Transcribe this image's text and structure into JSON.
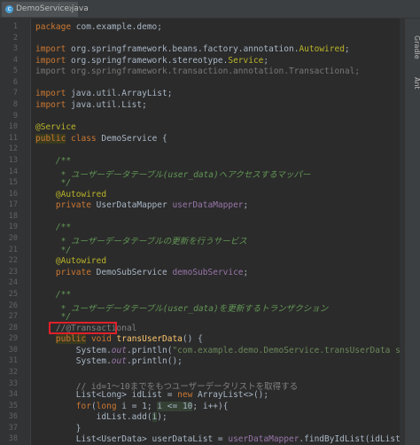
{
  "tab": {
    "label": "DemoService.java",
    "close": "×",
    "icon_letter": "c"
  },
  "right_panels": [
    "Gradle",
    "Ant"
  ],
  "lines": [
    {
      "n": "1",
      "segs": [
        {
          "t": "package ",
          "c": "kw"
        },
        {
          "t": "com.example.demo;",
          "c": ""
        }
      ]
    },
    {
      "n": "2",
      "segs": []
    },
    {
      "n": "3",
      "segs": [
        {
          "t": "import ",
          "c": "kw"
        },
        {
          "t": "org.springframework.beans.factory.annotation.",
          "c": ""
        },
        {
          "t": "Autowired",
          "c": "ann"
        },
        {
          "t": ";",
          "c": ""
        }
      ]
    },
    {
      "n": "4",
      "segs": [
        {
          "t": "import ",
          "c": "kw"
        },
        {
          "t": "org.springframework.stereotype.",
          "c": ""
        },
        {
          "t": "Service",
          "c": "ann"
        },
        {
          "t": ";",
          "c": ""
        }
      ]
    },
    {
      "n": "5",
      "segs": [
        {
          "t": "import org.springframework.transaction.annotation.Transactional;",
          "c": "gray"
        }
      ]
    },
    {
      "n": "6",
      "segs": []
    },
    {
      "n": "7",
      "segs": [
        {
          "t": "import ",
          "c": "kw"
        },
        {
          "t": "java.util.ArrayList;",
          "c": ""
        }
      ]
    },
    {
      "n": "8",
      "segs": [
        {
          "t": "import ",
          "c": "kw"
        },
        {
          "t": "java.util.List;",
          "c": ""
        }
      ]
    },
    {
      "n": "9",
      "segs": []
    },
    {
      "n": "10",
      "segs": [
        {
          "t": "@Service",
          "c": "ann"
        }
      ]
    },
    {
      "n": "11",
      "segs": [
        {
          "t": "public",
          "c": "kw-hl"
        },
        {
          "t": " class ",
          "c": "kw"
        },
        {
          "t": "DemoService {",
          "c": ""
        }
      ]
    },
    {
      "n": "12",
      "segs": []
    },
    {
      "n": "13",
      "segs": [
        {
          "t": "    /**",
          "c": "doc"
        }
      ]
    },
    {
      "n": "14",
      "segs": [
        {
          "t": "     * ユーザーデータテーブル(user_data)へアクセスするマッパー",
          "c": "doc"
        }
      ]
    },
    {
      "n": "15",
      "segs": [
        {
          "t": "     */",
          "c": "doc"
        }
      ]
    },
    {
      "n": "16",
      "segs": [
        {
          "t": "    @Autowired",
          "c": "ann"
        }
      ]
    },
    {
      "n": "17",
      "segs": [
        {
          "t": "    private ",
          "c": "kw"
        },
        {
          "t": "UserDataMapper ",
          "c": ""
        },
        {
          "t": "userDataMapper",
          "c": "fld"
        },
        {
          "t": ";",
          "c": ""
        }
      ]
    },
    {
      "n": "18",
      "segs": []
    },
    {
      "n": "19",
      "segs": [
        {
          "t": "    /**",
          "c": "doc"
        }
      ]
    },
    {
      "n": "20",
      "segs": [
        {
          "t": "     * ユーザーデータテーブルの更新を行うサービス",
          "c": "doc"
        }
      ]
    },
    {
      "n": "21",
      "segs": [
        {
          "t": "     */",
          "c": "doc"
        }
      ]
    },
    {
      "n": "22",
      "segs": [
        {
          "t": "    @Autowired",
          "c": "ann"
        }
      ]
    },
    {
      "n": "23",
      "segs": [
        {
          "t": "    private ",
          "c": "kw"
        },
        {
          "t": "DemoSubService ",
          "c": ""
        },
        {
          "t": "demoSubService",
          "c": "fld"
        },
        {
          "t": ";",
          "c": ""
        }
      ]
    },
    {
      "n": "24",
      "segs": []
    },
    {
      "n": "25",
      "segs": [
        {
          "t": "    /**",
          "c": "doc"
        }
      ]
    },
    {
      "n": "26",
      "segs": [
        {
          "t": "     * ユーザーデータテーブル(user_data)を更新するトランザクション",
          "c": "doc"
        }
      ]
    },
    {
      "n": "27",
      "segs": [
        {
          "t": "     */",
          "c": "doc"
        }
      ]
    },
    {
      "n": "28",
      "segs": [
        {
          "t": "    //@Transactional",
          "c": "cmt"
        }
      ]
    },
    {
      "n": "29",
      "segs": [
        {
          "t": "    ",
          "c": ""
        },
        {
          "t": "public",
          "c": "kw-hl"
        },
        {
          "t": " void ",
          "c": "kw"
        },
        {
          "t": "transUserData",
          "c": "meth"
        },
        {
          "t": "() {",
          "c": ""
        }
      ]
    },
    {
      "n": "30",
      "segs": [
        {
          "t": "        System.",
          "c": ""
        },
        {
          "t": "out",
          "c": "fld ital"
        },
        {
          "t": ".println(",
          "c": ""
        },
        {
          "t": "\"com.example.demo.DemoService.transUserData start.\"",
          "c": "str"
        },
        {
          "t": ");",
          "c": ""
        }
      ]
    },
    {
      "n": "31",
      "segs": [
        {
          "t": "        System.",
          "c": ""
        },
        {
          "t": "out",
          "c": "fld ital"
        },
        {
          "t": ".println();",
          "c": ""
        }
      ]
    },
    {
      "n": "32",
      "segs": []
    },
    {
      "n": "33",
      "segs": [
        {
          "t": "        // id=1～10までをもつユーザーデータリストを取得する",
          "c": "cmt"
        }
      ]
    },
    {
      "n": "34",
      "segs": [
        {
          "t": "        List<Long> idList = ",
          "c": ""
        },
        {
          "t": "new ",
          "c": "kw"
        },
        {
          "t": "ArrayList<>();",
          "c": ""
        }
      ]
    },
    {
      "n": "35",
      "segs": [
        {
          "t": "        ",
          "c": ""
        },
        {
          "t": "for",
          "c": "kw"
        },
        {
          "t": "(",
          "c": ""
        },
        {
          "t": "long ",
          "c": "kw"
        },
        {
          "t": "i = ",
          "c": ""
        },
        {
          "t": "1",
          "c": "num"
        },
        {
          "t": "; ",
          "c": ""
        },
        {
          "t": "i <= 10",
          "c": "hlvar"
        },
        {
          "t": "; i++){",
          "c": ""
        }
      ]
    },
    {
      "n": "36",
      "segs": [
        {
          "t": "            idList.add(",
          "c": ""
        },
        {
          "t": "i",
          "c": "hlvar"
        },
        {
          "t": ");",
          "c": ""
        }
      ]
    },
    {
      "n": "37",
      "segs": [
        {
          "t": "        }",
          "c": ""
        }
      ]
    },
    {
      "n": "38",
      "segs": [
        {
          "t": "        List<UserData> userDataList = ",
          "c": ""
        },
        {
          "t": "userDataMapper",
          "c": "fld"
        },
        {
          "t": ".findByIdList(idList);",
          "c": ""
        }
      ]
    }
  ]
}
